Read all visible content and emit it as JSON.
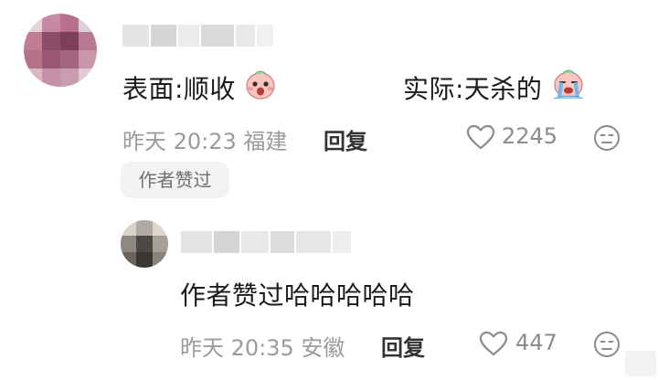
{
  "comments": [
    {
      "text_left": "表面:顺收",
      "text_right": "实际:天杀的",
      "emoji_left": "face-peeking-icon",
      "emoji_right": "face-crying-icon",
      "meta": "昨天 20:23 福建",
      "reply_label": "回复",
      "likes": "2245",
      "author_badge": "作者赞过"
    }
  ],
  "reply": {
    "text": "作者赞过哈哈哈哈哈",
    "meta": "昨天 20:35 安徽",
    "reply_label": "回复",
    "likes": "447"
  },
  "colors": {
    "meta_gray": "#9b9b9b",
    "badge_bg": "#f3f3f3",
    "icon_gray": "#8c8c8c",
    "emoji_pink": "#f4a6a2"
  }
}
